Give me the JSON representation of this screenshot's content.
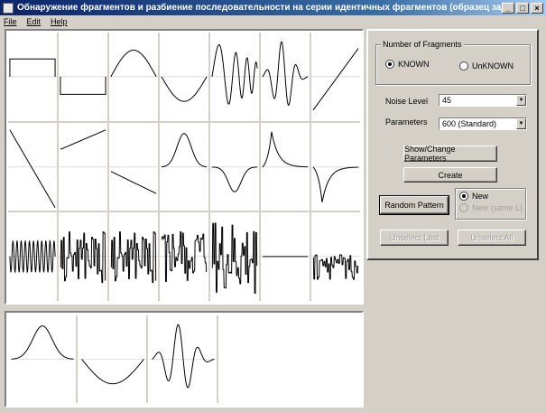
{
  "window": {
    "title": "Обнаружение фрагментов и разбиение последовательности на серии идентичных фрагментов (образец задан).",
    "min": "_",
    "max": "□",
    "close": "×"
  },
  "menu": {
    "file": "File",
    "edit": "Edit",
    "help": "Help"
  },
  "fragments_group": {
    "legend": "Number of Fragments",
    "known": "KNOWN",
    "unknown": "UnKNOWN",
    "selected": "KNOWN"
  },
  "noise": {
    "label": "Noise Level",
    "value": "45"
  },
  "parameters": {
    "label": "Parameters",
    "value": "600 (Standard)"
  },
  "buttons": {
    "show_change": "Show/Change Parameters",
    "create": "Create",
    "random_pattern": "Random Pattern",
    "unselect_last": "Unselect Last",
    "unselect_all": "Unselect All"
  },
  "pattern_mode": {
    "new": "New",
    "new_same": "New (same L)",
    "selected": "New"
  },
  "fragment_shapes": [
    "step-high",
    "step-low",
    "sine-hump",
    "sine-dip",
    "chirp-wave",
    "burst-wave",
    "ramp-up",
    "ramp-down",
    "ramp-up-offset",
    "ramp-down-low",
    "bell-peak",
    "bell-dip",
    "exp-spike",
    "exp-dip",
    "dense-oscillation",
    "noisy-wave-a",
    "noisy-wave-b",
    "noisy-spiky",
    "noisy-tall",
    "flat-empty",
    "noisy-low"
  ],
  "selected_shapes": [
    "bell-peak",
    "sine-dip",
    "burst-wave"
  ]
}
